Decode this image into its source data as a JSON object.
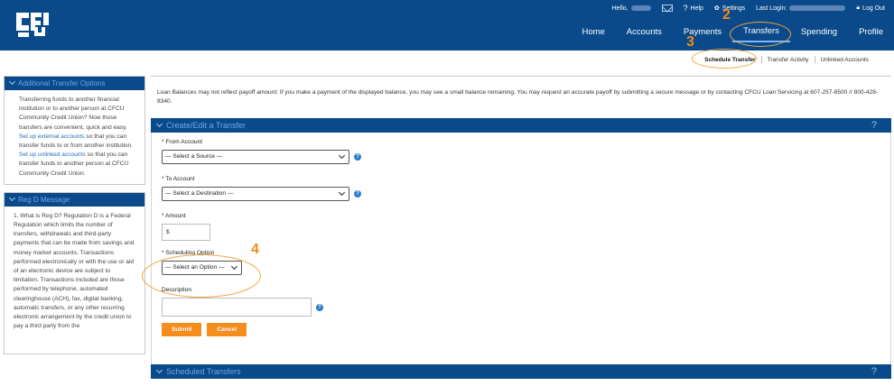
{
  "header": {
    "greeting": "Hello,",
    "help": "Help",
    "settings": "Settings",
    "last_login": "Last Login:",
    "logout": "Log Out",
    "nav": [
      "Home",
      "Accounts",
      "Payments",
      "Transfers",
      "Spending",
      "Profile"
    ],
    "active_nav": "Transfers"
  },
  "subnav": {
    "items": [
      "Schedule Transfer",
      "Transfer Activity",
      "Unlinked Accounts"
    ]
  },
  "sidebar": {
    "additional": {
      "title": "Additional Transfer Options",
      "text1": "Transferring funds to another financial institution or to another person at CFCU Community Credit Union? Now those transfers are convenient, quick and easy. ",
      "link1": "Set up external accounts",
      "text2": " so that you can transfer funds to or from another institution. ",
      "link2": "Set up unlinked accounts",
      "text3": " so that you can transfer funds to another person at CFCU Community Credit Union."
    },
    "regd": {
      "title": "Reg D Message",
      "text": "1. What is Reg D? Regulation D is a Federal Regulation which limits the number of transfers, withdrawals and third-party payments that can be made from savings and money market accounts. Transactions performed electronically or with the use or aid of an electronic device are subject to limitation. Transactions included are those performed by telephone, automated clearinghouse (ACH), fax, digital banking, automatic transfers, or any other recurring electronic arrangement by the credit union to pay a third party from the"
    }
  },
  "main": {
    "notice": "Loan Balances may not reflect payoff amount: If you make a payment of the displayed balance, you may see a small balance remaining. You may request an accurate payoff by submitting a secure message or by contacting CFCU Loan Servicing at 607-257-8500 // 800-428-8340.",
    "create_title": "Create/Edit a Transfer",
    "from_label": "* From Account",
    "from_value": "— Select a Source —",
    "to_label": "* To Account",
    "to_value": "— Select a Destination —",
    "amount_label": "* Amount",
    "amount_value": "$",
    "sched_label": "* Scheduling Option",
    "sched_value": "— Select an Option —",
    "desc_label": "Description",
    "submit": "Submit",
    "cancel": "Cancel",
    "scheduled_title": "Scheduled Transfers",
    "help_symbol": "?"
  },
  "annotations": [
    "2",
    "3",
    "4"
  ],
  "colors": {
    "brand": "#0a4a8a",
    "accent": "#f58c1e"
  }
}
